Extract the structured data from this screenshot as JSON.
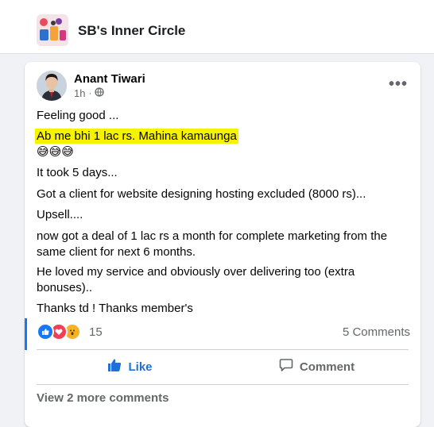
{
  "group": {
    "name": "SB's Inner Circle",
    "logo_icon": "group-cover-icon"
  },
  "post": {
    "author": "Anant Tiwari",
    "time": "1h",
    "separator": "·",
    "audience_icon": "globe-icon",
    "more_icon": "more-options-icon",
    "more_label": "•••",
    "lines": {
      "l1": "Feeling good ...",
      "l2": "Ab me bhi 1 lac rs. Mahina kamaunga",
      "l3": "😅😅😅",
      "l4": "It took 5 days...",
      "l5": "Got a client for website designing hosting excluded (8000 rs)...",
      "l6": "Upsell....",
      "l7": "now got a deal of 1 lac rs a month for complete marketing from the same client for next 6 months.",
      "l8": "He loved my service and obviously over delivering too (extra bonuses)..",
      "l9": "Thanks td ! Thanks member's"
    },
    "highlight_color": "#f7f200",
    "reactions": {
      "icons": [
        "like-reaction-icon",
        "love-reaction-icon",
        "wow-reaction-icon"
      ],
      "count": "15",
      "comments": "5 Comments"
    },
    "actions": {
      "like": "Like",
      "comment": "Comment"
    },
    "view_more": "View 2 more comments"
  },
  "colors": {
    "accent": "#1877f2",
    "like_text": "#216fdb",
    "muted": "#65676b"
  }
}
